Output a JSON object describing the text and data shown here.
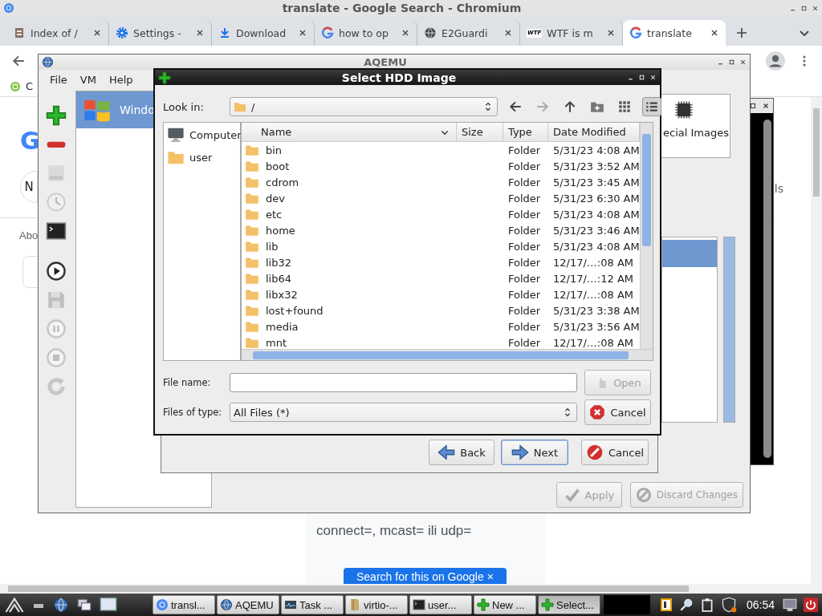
{
  "browser": {
    "title": "translate - Google Search - Chromium",
    "tabs": [
      {
        "label": "Index of /",
        "kind": "file",
        "selected": false
      },
      {
        "label": "Settings -",
        "kind": "gear",
        "selected": false
      },
      {
        "label": "Download",
        "kind": "download",
        "selected": false
      },
      {
        "label": "how to op",
        "kind": "google",
        "selected": false
      },
      {
        "label": "E2Guardi",
        "kind": "globe",
        "selected": false
      },
      {
        "label": "WTF is m",
        "kind": "badge",
        "favicon_text": "WTF",
        "selected": false
      },
      {
        "label": "translate",
        "kind": "google",
        "selected": true
      }
    ],
    "bookmark": "C",
    "page": {
      "logo_letter": "G",
      "chip": "N",
      "about": "Abo",
      "side_text": "ls",
      "snippet": "connect=, mcast= ili udp=",
      "search_button": "Search for this on Google ×"
    }
  },
  "aqemu": {
    "title": "AQEMU",
    "menu": [
      "File",
      "VM",
      "Help"
    ],
    "tools": [
      {
        "kind": "add",
        "disabled": false
      },
      {
        "kind": "remove",
        "disabled": false
      },
      {
        "kind": "disk",
        "disabled": true
      },
      {
        "kind": "clock",
        "disabled": true
      },
      {
        "kind": "terminal",
        "disabled": false
      },
      {
        "kind": "play",
        "disabled": false
      },
      {
        "kind": "save",
        "disabled": true
      },
      {
        "kind": "pause",
        "disabled": true
      },
      {
        "kind": "stop",
        "disabled": true
      },
      {
        "kind": "reload",
        "disabled": true
      }
    ],
    "vms": [
      {
        "label": "Windo",
        "selected": true
      }
    ],
    "device_label": "ecial Images",
    "device_rows": [
      {
        "selected": true
      }
    ],
    "buttons": [
      {
        "label": "Apply",
        "kind": "check",
        "disabled": true
      },
      {
        "label": "Discard Changes",
        "kind": "discard",
        "disabled": true
      }
    ]
  },
  "wizard": {
    "buttons": [
      {
        "label": "Back",
        "kind": "wback",
        "focused": false
      },
      {
        "label": "Next",
        "kind": "wnext",
        "focused": true
      },
      {
        "label": "Cancel",
        "kind": "nocancel",
        "focused": false
      }
    ]
  },
  "dialog": {
    "title": "Select HDD Image",
    "look_in_label": "Look in:",
    "path": "/",
    "nav": [
      {
        "kind": "back",
        "disabled": false,
        "selected": false
      },
      {
        "kind": "forward",
        "disabled": true,
        "selected": false
      },
      {
        "kind": "up",
        "disabled": false,
        "selected": false
      },
      {
        "kind": "newfolder",
        "disabled": false,
        "selected": false
      },
      {
        "kind": "grid",
        "disabled": false,
        "selected": false
      },
      {
        "kind": "list",
        "disabled": false,
        "selected": true
      }
    ],
    "places": [
      {
        "label": "Computer",
        "kind": "computer"
      },
      {
        "label": "user",
        "kind": "folder"
      }
    ],
    "columns": [
      "Name",
      "Size",
      "Type",
      "Date Modified"
    ],
    "files": [
      {
        "name": "bin",
        "type": "Folder",
        "modified": "5/31/23 4:08 AM"
      },
      {
        "name": "boot",
        "type": "Folder",
        "modified": "5/31/23 3:52 AM"
      },
      {
        "name": "cdrom",
        "type": "Folder",
        "modified": "5/31/23 3:45 AM"
      },
      {
        "name": "dev",
        "type": "Folder",
        "modified": "5/31/23 6:30 AM"
      },
      {
        "name": "etc",
        "type": "Folder",
        "modified": "5/31/23 4:08 AM"
      },
      {
        "name": "home",
        "type": "Folder",
        "modified": "5/31/23 3:46 AM"
      },
      {
        "name": "lib",
        "type": "Folder",
        "modified": "5/31/23 4:08 AM"
      },
      {
        "name": "lib32",
        "type": "Folder",
        "modified": "12/17/…:08 AM"
      },
      {
        "name": "lib64",
        "type": "Folder",
        "modified": "12/17/…:12 AM"
      },
      {
        "name": "libx32",
        "type": "Folder",
        "modified": "12/17/…:08 AM"
      },
      {
        "name": "lost+found",
        "type": "Folder",
        "modified": "5/31/23 3:38 AM"
      },
      {
        "name": "media",
        "type": "Folder",
        "modified": "5/31/23 3:56 AM"
      },
      {
        "name": "mnt",
        "type": "Folder",
        "modified": "12/17/…:08 AM"
      }
    ],
    "file_name_label": "File name:",
    "open_button": {
      "label": "Open",
      "disabled": true
    },
    "type_label": "Files of type:",
    "file_type": "All Files (*)",
    "cancel_button": "Cancel"
  },
  "taskbar": {
    "tasks": [
      {
        "label": "transl...",
        "kind": "chromium",
        "selected": false
      },
      {
        "label": "AQEMU",
        "kind": "bluegl",
        "selected": false
      },
      {
        "label": "Task ...",
        "kind": "graph",
        "selected": false
      },
      {
        "label": "virtio-...",
        "kind": "bfolder",
        "selected": false
      },
      {
        "label": "user...",
        "kind": "terminal",
        "selected": false
      },
      {
        "label": "New ...",
        "kind": "add",
        "selected": false
      },
      {
        "label": "Select...",
        "kind": "add",
        "selected": true
      }
    ],
    "clock": "06:54"
  }
}
